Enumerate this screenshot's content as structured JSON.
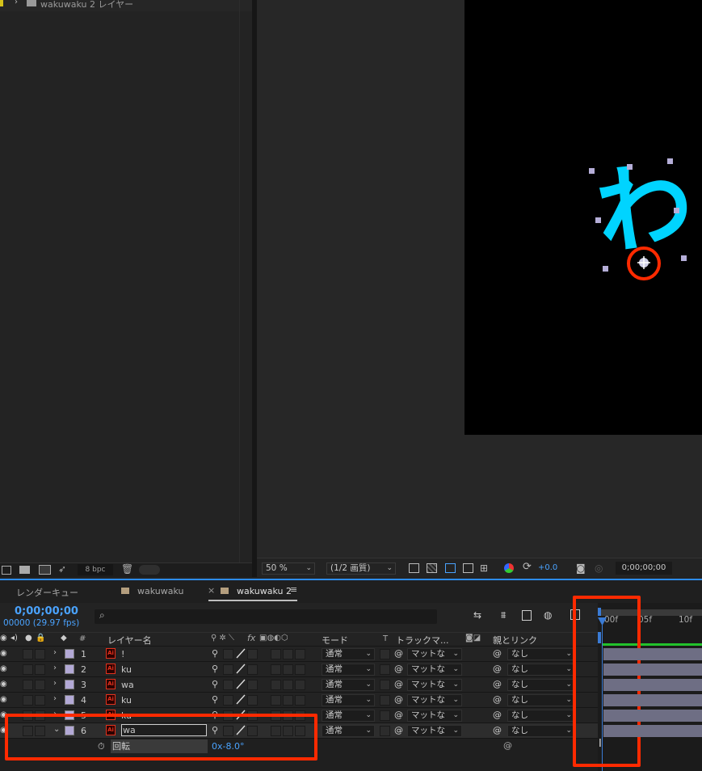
{
  "project": {
    "item_name": "wakuwaku 2 レイヤー",
    "bpc": "8 bpc"
  },
  "viewer": {
    "zoom": "50 %",
    "resolution": "(1/2 画質)",
    "exposure": "+0.0",
    "timecode": "0;00;00;00",
    "glyph": "わ"
  },
  "timeline_tabs": [
    {
      "label": "レンダーキュー"
    },
    {
      "label": "wakuwaku"
    },
    {
      "label": "wakuwaku 2"
    }
  ],
  "close_glyph": "×",
  "menu_glyph": "≡",
  "current_time": "0;00;00;00",
  "frame_info": "00000 (29.97 fps)",
  "headers": {
    "num": "#",
    "layer_name": "レイヤー名",
    "mode": "モード",
    "t": "T",
    "track_matte": "トラックマ...",
    "parent": "親とリンク",
    "fx": "fx"
  },
  "ruler": {
    "t0": "00f",
    "t5": "05f",
    "t10": "10f"
  },
  "layers": [
    {
      "num": "1",
      "name": "!",
      "mode": "通常",
      "matte": "マットな",
      "parent": "なし"
    },
    {
      "num": "2",
      "name": "ku",
      "mode": "通常",
      "matte": "マットな",
      "parent": "なし"
    },
    {
      "num": "3",
      "name": "wa",
      "mode": "通常",
      "matte": "マットな",
      "parent": "なし"
    },
    {
      "num": "4",
      "name": "ku",
      "mode": "通常",
      "matte": "マットな",
      "parent": "なし"
    },
    {
      "num": "5",
      "name": "ku",
      "mode": "通常",
      "matte": "マットな",
      "parent": "なし"
    },
    {
      "num": "6",
      "name": "wa",
      "mode": "通常",
      "matte": "マットな",
      "parent": "なし"
    }
  ],
  "rotation": {
    "label": "回転",
    "value": "0x-8.0°"
  },
  "colors": {
    "accent_blue": "#2d8ceb",
    "glyph_cyan": "#00d4ff",
    "red_annotation": "#ff2a00"
  }
}
